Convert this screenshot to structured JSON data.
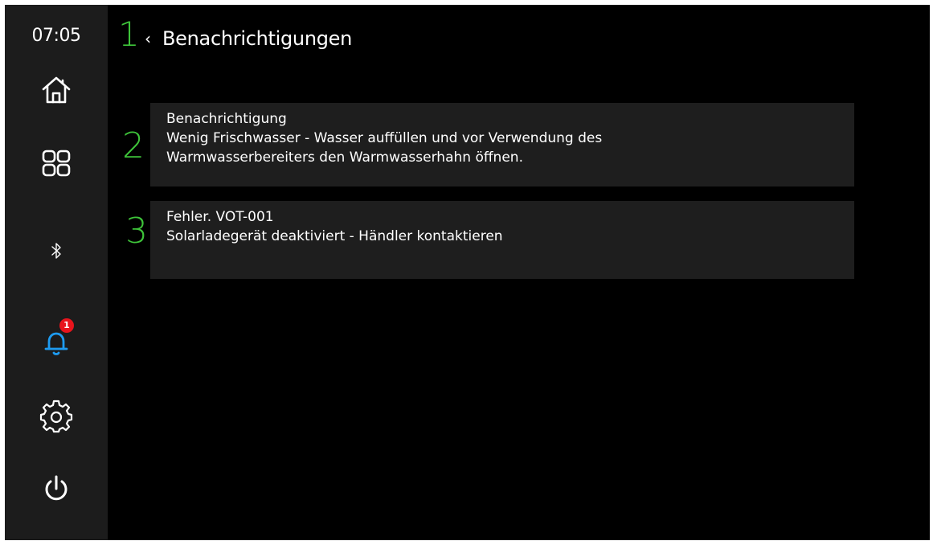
{
  "status_bar": {
    "time": "07:05"
  },
  "sidebar": {
    "items": [
      {
        "name": "home",
        "icon": "home-icon"
      },
      {
        "name": "apps",
        "icon": "grid-icon"
      },
      {
        "name": "bluetooth",
        "icon": "bluetooth-icon"
      },
      {
        "name": "notifications",
        "icon": "bell-icon",
        "badge": "1",
        "active": true,
        "color": "#1e9bf0"
      },
      {
        "name": "settings",
        "icon": "gear-icon"
      },
      {
        "name": "power",
        "icon": "power-icon"
      }
    ],
    "badge_color": "#e8141c"
  },
  "annotations": [
    "1",
    "2",
    "3"
  ],
  "header": {
    "back_icon": "chevron-left-icon",
    "title": "Benachrichtigungen"
  },
  "notifications": [
    {
      "heading": "Benachrichtigung",
      "lines": [
        "Wenig Frischwasser - Wasser auffüllen und vor Verwendung des",
        "Warmwasserbereiters den Warmwasserhahn öffnen."
      ]
    },
    {
      "heading": "Fehler. VOT-001",
      "lines": [
        "Solarladegerät deaktiviert - Händler kontaktieren"
      ]
    }
  ],
  "colors": {
    "accent_green": "#3ec43a",
    "active_blue": "#1e9bf0"
  }
}
